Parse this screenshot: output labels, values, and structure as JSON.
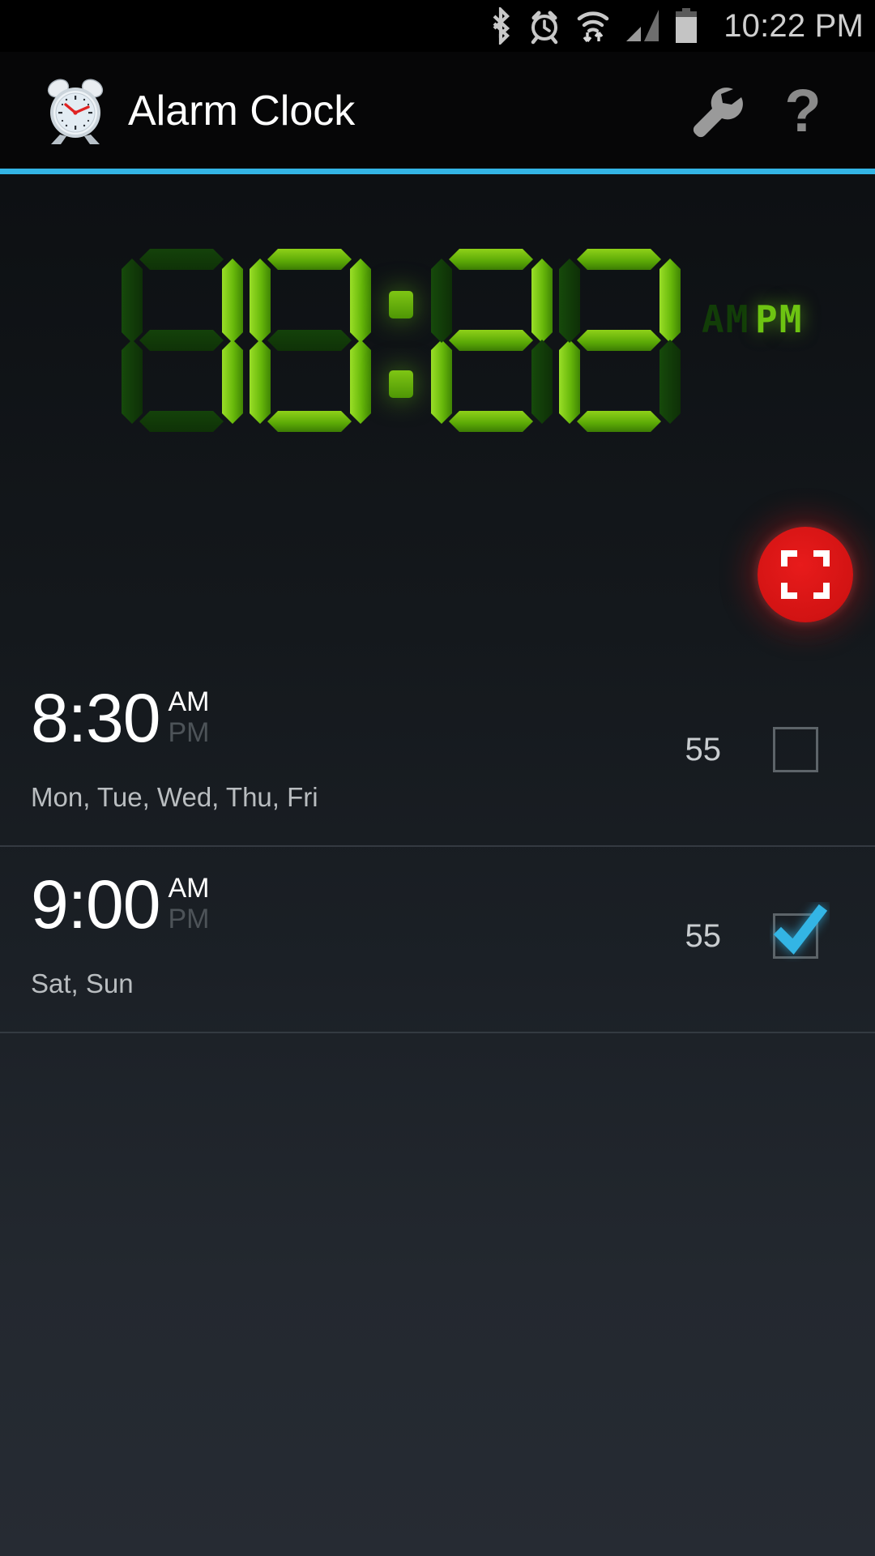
{
  "status_bar": {
    "time": "10:22 PM",
    "icons": [
      {
        "name": "bluetooth-icon",
        "label": "Bluetooth"
      },
      {
        "name": "alarm-set-icon",
        "label": "Alarm set"
      },
      {
        "name": "wifi-icon",
        "label": "Wi-Fi with data transfer"
      },
      {
        "name": "cellular-signal-icon",
        "label": "Cellular signal"
      },
      {
        "name": "battery-icon",
        "label": "Battery"
      }
    ]
  },
  "app_bar": {
    "title": "Alarm Clock",
    "logo_icon": "alarm-clock-logo-icon",
    "settings_icon": "wrench-icon",
    "help_icon": "question-mark-icon",
    "accent_color": "#33b5e5"
  },
  "led_clock": {
    "hours": "10",
    "minutes": "22",
    "separator": ":",
    "meridiem_am": "AM",
    "meridiem_pm": "PM",
    "active_meridiem": "PM",
    "on_color": "#6dc412",
    "off_color": "#143f09",
    "digits": [
      {
        "value": "1",
        "segments": {
          "a": false,
          "b": true,
          "c": true,
          "d": false,
          "e": false,
          "f": false,
          "g": false
        }
      },
      {
        "value": "0",
        "segments": {
          "a": true,
          "b": true,
          "c": true,
          "d": true,
          "e": true,
          "f": true,
          "g": false
        }
      },
      {
        "value": "2",
        "segments": {
          "a": true,
          "b": true,
          "c": false,
          "d": true,
          "e": true,
          "f": false,
          "g": true
        }
      },
      {
        "value": "2",
        "segments": {
          "a": true,
          "b": true,
          "c": false,
          "d": true,
          "e": true,
          "f": false,
          "g": true
        }
      }
    ]
  },
  "fullscreen_button": {
    "icon": "fullscreen-expand-icon",
    "color": "#d21313"
  },
  "alarms": [
    {
      "time": "8:30",
      "meridiem_am": "AM",
      "meridiem_pm": "PM",
      "active_meridiem": "AM",
      "days": "Mon, Tue, Wed, Thu, Fri",
      "label": "55",
      "enabled": false
    },
    {
      "time": "9:00",
      "meridiem_am": "AM",
      "meridiem_pm": "PM",
      "active_meridiem": "AM",
      "days": "Sat, Sun",
      "label": "55",
      "enabled": true
    }
  ]
}
